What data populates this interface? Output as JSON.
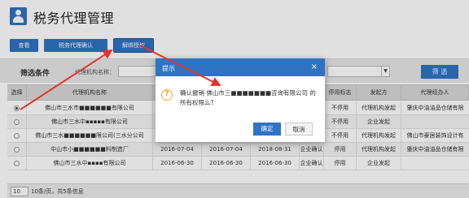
{
  "app": {
    "title": "税务代理管理"
  },
  "toolbar": {
    "view_label": "查看",
    "auth_label": "税务代理确认",
    "revoke_label": "解绑授权"
  },
  "filter": {
    "title": "筛选条件",
    "agency_label": "代理机构名称：",
    "search_label": "筛 选"
  },
  "table": {
    "headers": [
      "选择",
      "代理机构名称",
      "",
      "",
      "",
      "",
      "停用标志",
      "发起方",
      "代理经办人"
    ],
    "rows": [
      {
        "selected": true,
        "name": "佛山市三水市■■■■■■有限公司",
        "d1": "",
        "d2": "",
        "d3": "",
        "type": "",
        "status": "不停用",
        "initiator": "代理机构发起",
        "agent": "肇庆中油油品仓储有限"
      },
      {
        "selected": false,
        "name": "佛山市三水中▪▪▪▪▪有限公司",
        "d1": "",
        "d2": "",
        "d3": "",
        "type": "",
        "status": "不停用",
        "initiator": "企业发起",
        "agent": ""
      },
      {
        "selected": false,
        "name": "佛山市三水■■■■■■限公司(三水分公司",
        "d1": "",
        "d2": "",
        "d3": "",
        "type": "",
        "status": "不停用",
        "initiator": "代理机构发起",
        "agent": "佛山市豪居装饰设计有"
      },
      {
        "selected": false,
        "name": "中山市小■■■■■■料制造厂",
        "d1": "2016-07-04",
        "d2": "2016-07-04",
        "d3": "2018-08-31",
        "type": "企业确认",
        "status": "停用",
        "initiator": "代理机构发起",
        "agent": "肇庆中油油品仓储有限"
      },
      {
        "selected": false,
        "name": "佛山市三水中▪▪▪▪有限公司",
        "d1": "2016-06-30",
        "d2": "2016-06-30",
        "d3": "2016-06-30",
        "type": "企业确认",
        "status": "停用",
        "initiator": "企业发起",
        "agent": ""
      }
    ]
  },
  "pager": {
    "page_size": "10",
    "summary": "10条/页，共5条信息"
  },
  "dialog": {
    "title": "提示",
    "close_glyph": "×",
    "warn_glyph": "?",
    "message": "确认撤销 佛山市三■■■■■■■咨询有限公司 的所有权限么?",
    "ok_label": "确定",
    "cancel_label": "取消"
  },
  "colors": {
    "primary": "#2f73c3",
    "arrow": "#e6332a",
    "warning": "#f0a623"
  }
}
